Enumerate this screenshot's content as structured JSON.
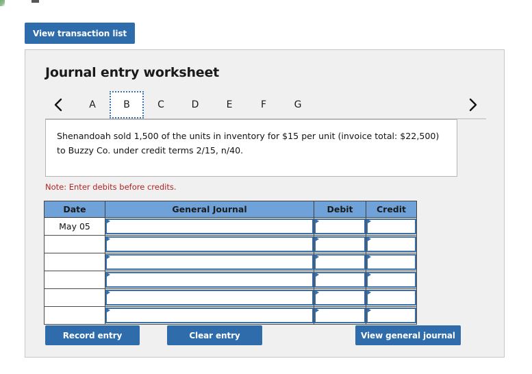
{
  "toolbar": {
    "view_transaction_list_label": "View transaction list"
  },
  "worksheet": {
    "title": "Journal entry worksheet",
    "tabs": [
      {
        "label": "A",
        "active": false
      },
      {
        "label": "B",
        "active": true
      },
      {
        "label": "C",
        "active": false
      },
      {
        "label": "D",
        "active": false
      },
      {
        "label": "E",
        "active": false
      },
      {
        "label": "F",
        "active": false
      },
      {
        "label": "G",
        "active": false
      }
    ],
    "prev_arrow_icon": "chevron-left-icon",
    "next_arrow_icon": "chevron-right-icon",
    "instruction": "Shenandoah sold 1,500 of the units in inventory for $15 per unit (invoice total: $22,500) to Buzzy Co. under credit terms 2/15, n/40.",
    "note": "Note: Enter debits before credits."
  },
  "table": {
    "headers": [
      "Date",
      "General Journal",
      "Debit",
      "Credit"
    ],
    "rows": [
      {
        "date": "May 05",
        "general_journal": "",
        "debit": "",
        "credit": ""
      },
      {
        "date": "",
        "general_journal": "",
        "debit": "",
        "credit": ""
      },
      {
        "date": "",
        "general_journal": "",
        "debit": "",
        "credit": ""
      },
      {
        "date": "",
        "general_journal": "",
        "debit": "",
        "credit": ""
      },
      {
        "date": "",
        "general_journal": "",
        "debit": "",
        "credit": ""
      },
      {
        "date": "",
        "general_journal": "",
        "debit": "",
        "credit": ""
      }
    ]
  },
  "actions": {
    "record_entry_label": "Record entry",
    "clear_entry_label": "Clear entry",
    "view_general_journal_label": "View general journal"
  },
  "colors": {
    "button_blue": "#2f6cac",
    "table_header_blue": "#6fa2d8",
    "input_border_blue": "#3a6ea8",
    "note_red": "#b22222",
    "panel_bg": "#f0f0f0"
  }
}
